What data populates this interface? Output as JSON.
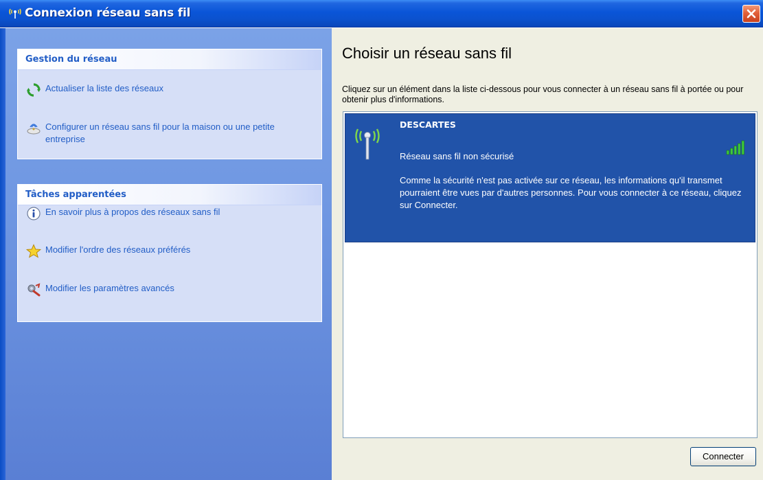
{
  "window": {
    "title": "Connexion réseau sans fil",
    "title_icon": "wireless-icon",
    "close_icon": "close-icon"
  },
  "left": {
    "network_tasks": {
      "header": "Gestion du réseau",
      "items": [
        {
          "label": "Actualiser la liste des réseaux",
          "icon": "refresh-icon"
        },
        {
          "label": "Configurer un réseau sans fil pour la maison ou une petite entreprise",
          "icon": "setup-wizard-icon"
        }
      ]
    },
    "related_tasks": {
      "header": "Tâches apparentées",
      "items": [
        {
          "label": "En savoir plus à propos des réseaux sans fil",
          "icon": "info-icon"
        },
        {
          "label": "Modifier l'ordre des réseaux préférés",
          "icon": "star-icon"
        },
        {
          "label": "Modifier les paramètres avancés",
          "icon": "advanced-settings-icon"
        }
      ]
    }
  },
  "main": {
    "title": "Choisir un réseau sans fil",
    "description": "Cliquez sur un élément dans la liste ci-dessous pour vous connecter à un réseau sans fil à portée ou pour obtenir plus d'informations.",
    "networks": [
      {
        "name": "DESCARTES",
        "security": "Réseau sans fil non sécurisé",
        "details": "Comme la sécurité n'est pas activée sur ce réseau, les informations qu'il transmet pourraient être vues par d'autres personnes. Pour vous connecter à ce réseau, cliquez sur Connecter.",
        "icon": "wireless-antenna-icon",
        "signal_icon": "signal-strength-icon",
        "signal_bars": 5
      }
    ],
    "connect_label": "Connecter"
  },
  "colors": {
    "title_bar": "#0a55d8",
    "task_pane": "#6f97e2",
    "task_link": "#215dc6",
    "selection": "#2153a9",
    "signal": "#3ec83e"
  }
}
